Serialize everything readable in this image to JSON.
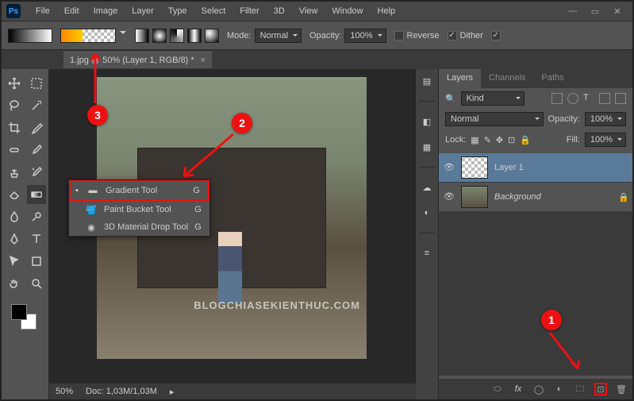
{
  "menu": {
    "items": [
      "File",
      "Edit",
      "Image",
      "Layer",
      "Type",
      "Select",
      "Filter",
      "3D",
      "View",
      "Window",
      "Help"
    ]
  },
  "options_bar": {
    "mode_label": "Mode:",
    "mode_value": "Normal",
    "opacity_label": "Opacity:",
    "opacity_value": "100%",
    "reverse_label": "Reverse",
    "dither_label": "Dither"
  },
  "doc_tab": {
    "title": "1.jpg @ 50% (Layer 1, RGB/8) *"
  },
  "tool_menu": {
    "items": [
      {
        "label": "Gradient Tool",
        "key": "G",
        "selected": true
      },
      {
        "label": "Paint Bucket Tool",
        "key": "G"
      },
      {
        "label": "3D Material Drop Tool",
        "key": "G"
      }
    ]
  },
  "status": {
    "zoom": "50%",
    "doc_label": "Doc:",
    "doc_value": "1,03M/1,03M"
  },
  "layers_panel": {
    "tabs": [
      "Layers",
      "Channels",
      "Paths"
    ],
    "filter_label": "Kind",
    "blend_mode": "Normal",
    "opacity_label": "Opacity:",
    "opacity_value": "100%",
    "lock_label": "Lock:",
    "fill_label": "Fill:",
    "fill_value": "100%",
    "layers": [
      {
        "name": "Layer 1",
        "transparent": true,
        "selected": true
      },
      {
        "name": "Background",
        "italic": true,
        "locked": true
      }
    ]
  },
  "callouts": {
    "c1": "1",
    "c2": "2",
    "c3": "3"
  },
  "watermark": "BLOGCHIASEKIENTHUC.COM"
}
